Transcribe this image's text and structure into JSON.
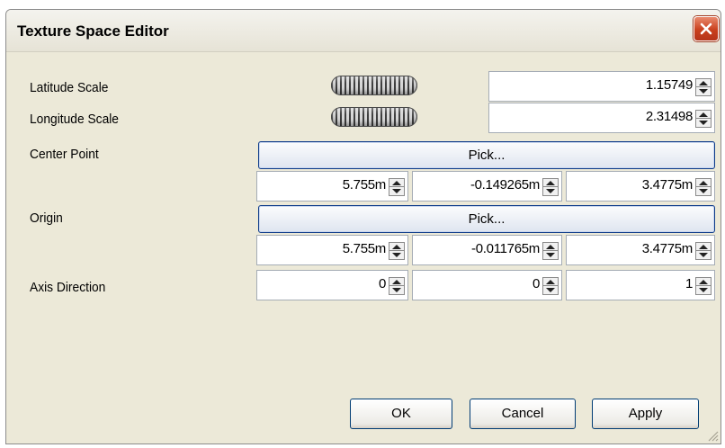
{
  "window": {
    "title": "Texture Space Editor"
  },
  "latitude_scale": {
    "label": "Latitude Scale",
    "value": "1.15749"
  },
  "longitude_scale": {
    "label": "Longitude Scale",
    "value": "2.31498"
  },
  "center_point": {
    "label": "Center Point",
    "pick_label": "Pick...",
    "x": "5.755m",
    "y": "-0.149265m",
    "z": "3.4775m"
  },
  "origin": {
    "label": "Origin",
    "pick_label": "Pick...",
    "x": "5.755m",
    "y": "-0.011765m",
    "z": "3.4775m"
  },
  "axis_direction": {
    "label": "Axis Direction",
    "x": "0",
    "y": "0",
    "z": "1"
  },
  "buttons": {
    "ok": "OK",
    "cancel": "Cancel",
    "apply": "Apply"
  },
  "colors": {
    "dialog_bg": "#ece9d8",
    "pick_border": "#0f3c8a",
    "close_red": "#c9401d"
  }
}
